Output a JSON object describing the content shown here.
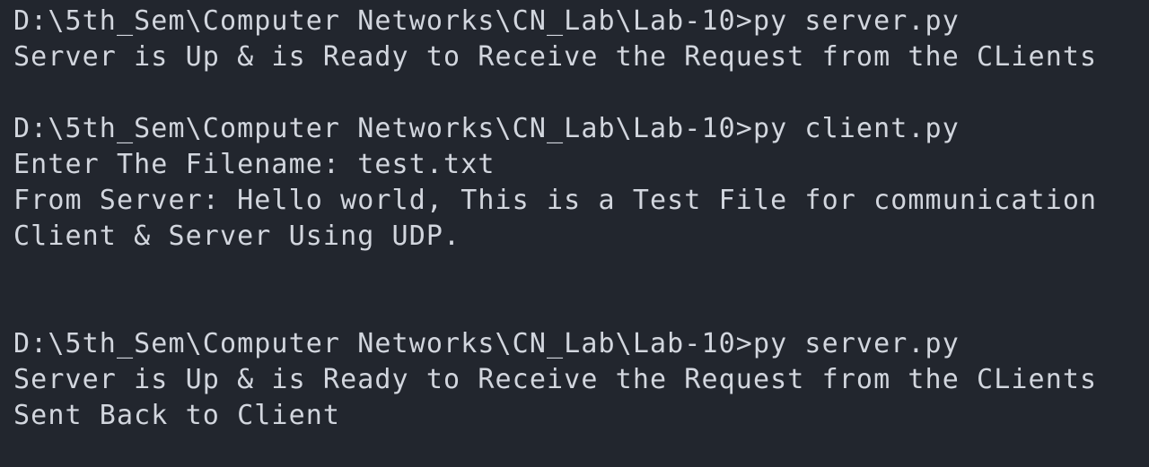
{
  "terminal": {
    "background_color": "#22262e",
    "text_color": "#d2d6de",
    "lines": [
      "D:\\5th_Sem\\Computer Networks\\CN_Lab\\Lab-10>py server.py",
      "Server is Up & is Ready to Receive the Request from the CLients",
      "",
      "D:\\5th_Sem\\Computer Networks\\CN_Lab\\Lab-10>py client.py",
      "Enter The Filename: test.txt",
      "From Server: Hello world, This is a Test File for communication",
      "Client & Server Using UDP.",
      "",
      "",
      "D:\\5th_Sem\\Computer Networks\\CN_Lab\\Lab-10>py server.py",
      "Server is Up & is Ready to Receive the Request from the CLients",
      "Sent Back to Client"
    ]
  }
}
